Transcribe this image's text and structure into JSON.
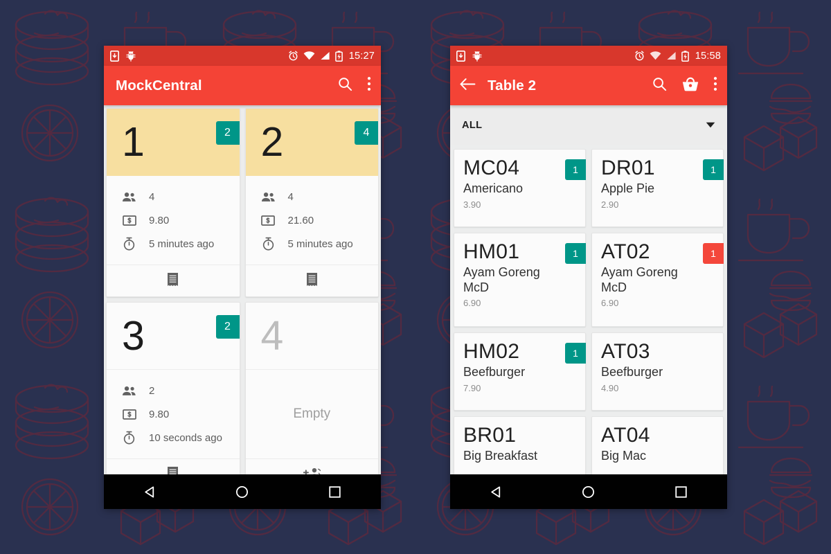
{
  "background": {
    "color": "#2a3150",
    "pattern_line_color": "#7a2434",
    "motif": "food-doodles"
  },
  "theme": {
    "app_bar": "#f44336",
    "status_bar": "#d8372c",
    "badge_teal": "#009688",
    "badge_red": "#f4473b",
    "table_occupied_header": "#f7dfa0",
    "surface": "#fbfbfb",
    "page_bg": "#eceded"
  },
  "phones": [
    {
      "id": "tables",
      "status_bar": {
        "time": "15:27",
        "left_icons": [
          "sd-download-icon",
          "android-debug-bug-icon"
        ],
        "right_icons": [
          "alarm-icon",
          "wifi-icon",
          "signal-icon",
          "battery-charging-icon"
        ]
      },
      "app_bar": {
        "title": "MockCentral",
        "actions": [
          "search-icon",
          "overflow-menu-icon"
        ]
      },
      "tables": [
        {
          "number": "1",
          "badge": "2",
          "badge_color": "#009688",
          "occupied": true,
          "people_icon": "people-icon",
          "people": "4",
          "money_icon": "money-icon",
          "amount": "9.80",
          "time_icon": "timer-icon",
          "elapsed": "5 minutes ago",
          "action_icon": "receipt-icon"
        },
        {
          "number": "2",
          "badge": "4",
          "badge_color": "#009688",
          "occupied": true,
          "people_icon": "people-icon",
          "people": "4",
          "money_icon": "money-icon",
          "amount": "21.60",
          "time_icon": "timer-icon",
          "elapsed": "5 minutes ago",
          "action_icon": "receipt-icon"
        },
        {
          "number": "3",
          "badge": "2",
          "badge_color": "#009688",
          "occupied": true,
          "people_icon": "people-icon",
          "people": "2",
          "money_icon": "money-icon",
          "amount": "9.80",
          "time_icon": "timer-icon",
          "elapsed": "10 seconds ago",
          "action_icon": "receipt-icon"
        },
        {
          "number": "4",
          "badge": null,
          "occupied": false,
          "empty_label": "Empty",
          "action_icon": "add-people-icon"
        }
      ],
      "nav_bar": [
        "back-triangle-icon",
        "home-circle-icon",
        "recents-square-icon"
      ]
    },
    {
      "id": "menu",
      "status_bar": {
        "time": "15:58",
        "left_icons": [
          "sd-download-icon",
          "android-debug-bug-icon"
        ],
        "right_icons": [
          "alarm-icon",
          "wifi-icon",
          "signal-icon",
          "battery-charging-icon"
        ]
      },
      "app_bar": {
        "back_icon": "arrow-back-icon",
        "title": "Table 2",
        "actions": [
          "search-icon",
          "basket-icon",
          "overflow-menu-icon"
        ]
      },
      "filter": {
        "selected": "ALL",
        "caret_icon": "chevron-down-icon"
      },
      "menu_items": [
        {
          "code": "MC04",
          "name": "Americano",
          "price": "3.90",
          "badge": "1",
          "badge_color": "#009688"
        },
        {
          "code": "DR01",
          "name": "Apple Pie",
          "price": "2.90",
          "badge": "1",
          "badge_color": "#009688"
        },
        {
          "code": "HM01",
          "name": "Ayam Goreng McD",
          "price": "6.90",
          "badge": "1",
          "badge_color": "#009688"
        },
        {
          "code": "AT02",
          "name": "Ayam Goreng McD",
          "price": "6.90",
          "badge": "1",
          "badge_color": "#f4473b"
        },
        {
          "code": "HM02",
          "name": "Beefburger",
          "price": "7.90",
          "badge": "1",
          "badge_color": "#009688"
        },
        {
          "code": "AT03",
          "name": "Beefburger",
          "price": "4.90",
          "badge": null,
          "badge_color": null
        },
        {
          "code": "BR01",
          "name": "Big Breakfast",
          "price": "",
          "badge": null,
          "badge_color": null
        },
        {
          "code": "AT04",
          "name": "Big Mac",
          "price": "",
          "badge": null,
          "badge_color": null
        }
      ],
      "nav_bar": [
        "back-triangle-icon",
        "home-circle-icon",
        "recents-square-icon"
      ]
    }
  ]
}
